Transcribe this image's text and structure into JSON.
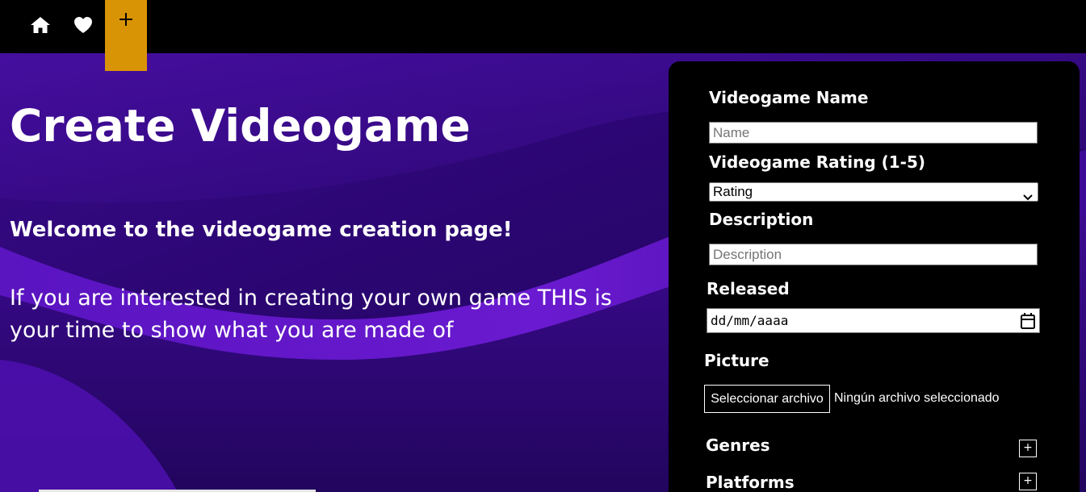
{
  "nav": {
    "home_icon": "home-icon",
    "favorites_icon": "heart-icon",
    "create_icon": "plus-icon",
    "create_label": "+",
    "active_color": "#d99406"
  },
  "hero": {
    "title": "Create Videogame",
    "welcome": "Welcome to the videogame creation page!",
    "text": "If you are interested in creating your own game THIS is your time to show what you are made of"
  },
  "form": {
    "name_label": "Videogame Name",
    "name_placeholder": "Name",
    "rating_label": "Videogame Rating (1-5)",
    "rating_selected": "Rating",
    "description_label": "Description",
    "description_placeholder": "Description",
    "released_label": "Released",
    "released_value": "dd/mm/aaaa",
    "picture_label": "Picture",
    "file_button": "Seleccionar archivo",
    "file_status": "Ningún archivo seleccionado",
    "genres_label": "Genres",
    "platforms_label": "Platforms",
    "expand_label": "+"
  }
}
